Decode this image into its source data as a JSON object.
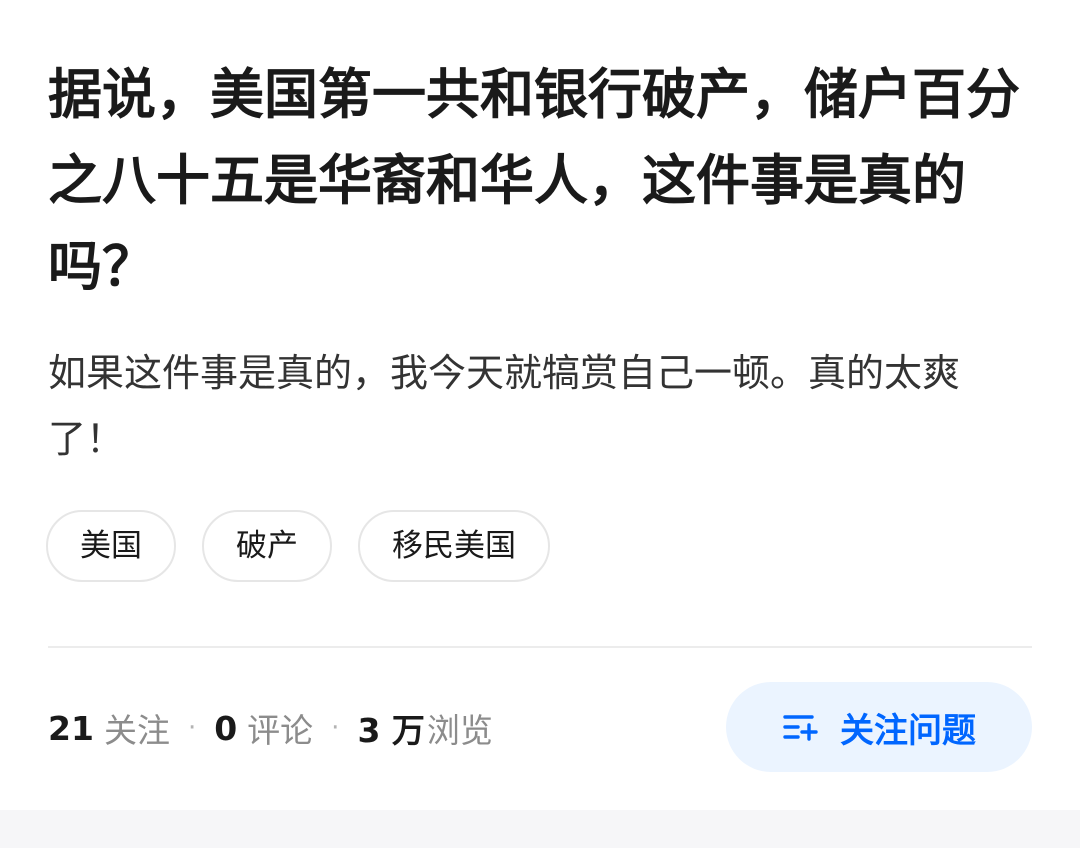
{
  "question": {
    "title": "据说，美国第一共和银行破产，储户百分之八十五是华裔和华人，这件事是真的吗？",
    "detail": "如果这件事是真的，我今天就犒赏自己一顿。真的太爽了！",
    "tags": [
      "美国",
      "破产",
      "移民美国"
    ]
  },
  "stats": {
    "followers_count": "21",
    "followers_label": "关注",
    "comments_count": "0",
    "comments_label": "评论",
    "views_count": "3 万",
    "views_label": "浏览",
    "separator": "·"
  },
  "follow_button": {
    "label": "关注问题",
    "icon": "add-to-list-icon"
  },
  "colors": {
    "accent": "#0066ff",
    "accent_bg": "#ebf4ff",
    "muted_text": "#8c8c8c",
    "tag_border": "#e6e6e6"
  }
}
